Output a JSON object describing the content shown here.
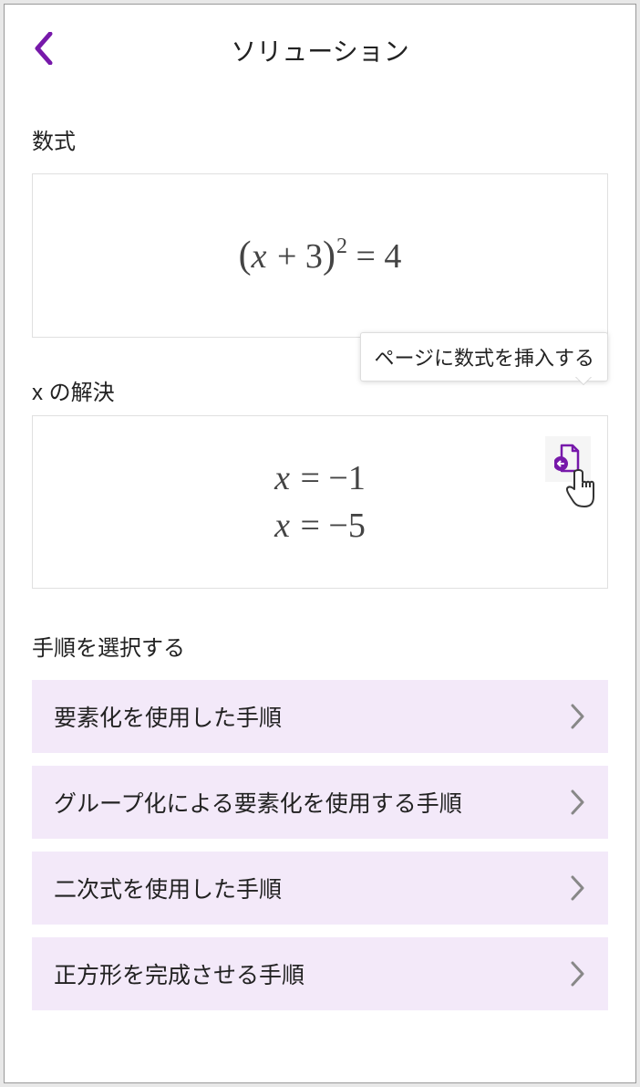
{
  "header": {
    "title": "ソリューション"
  },
  "equation": {
    "label": "数式",
    "var": "x",
    "plus": " + 3",
    "exp": "2",
    "equals": " = 4"
  },
  "solutions": {
    "label": "x の解決",
    "tooltip": "ページに数式を挿入する",
    "line1_var": "x",
    "line1_rest": " = −1",
    "line2_var": "x",
    "line2_rest": " = −5"
  },
  "steps": {
    "label": "手順を選択する",
    "items": [
      "要素化を使用した手順",
      "グループ化による要素化を使用する手順",
      "二次式を使用した手順",
      "正方形を完成させる手順"
    ]
  }
}
